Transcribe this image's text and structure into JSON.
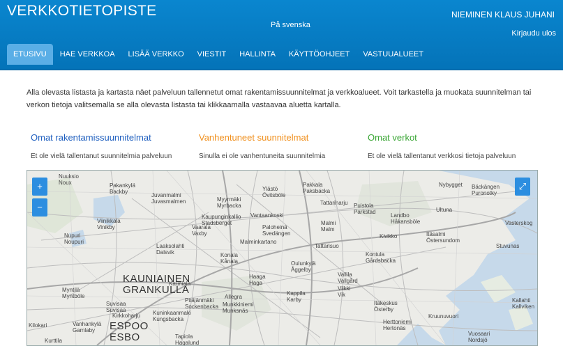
{
  "header": {
    "brand": "VERKKOTIETOPISTE",
    "language_link": "På svenska",
    "user_name": "NIEMINEN KLAUS JUHANI",
    "logout": "Kirjaudu ulos"
  },
  "nav": {
    "tabs": [
      {
        "label": "ETUSIVU",
        "active": true
      },
      {
        "label": "HAE VERKKOA",
        "active": false
      },
      {
        "label": "LISÄÄ VERKKO",
        "active": false
      },
      {
        "label": "VIESTIT",
        "active": false
      },
      {
        "label": "HALLINTA",
        "active": false
      },
      {
        "label": "KÄYTTÖOHJEET",
        "active": false
      },
      {
        "label": "VASTUUALUEET",
        "active": false
      }
    ]
  },
  "intro": "Alla olevasta listasta ja kartasta näet palveluun tallennetut omat rakentamissuunnitelmat ja verkkoalueet. Voit tarkastella ja muokata suunnitelman tai verkon tietoja valitsemalla se alla olevasta listasta tai klikkaamalla vastaavaa aluetta kartalla.",
  "sections": {
    "plans": {
      "title": "Omat rakentamissuunnitelmat",
      "text": "Et ole vielä tallentanut suunnitelmia palveluun",
      "color": "#1f5fbf"
    },
    "expired": {
      "title": "Vanhentuneet suunnitelmat",
      "text": "Sinulla ei ole vanhentuneita suunnitelmia",
      "color": "#f0901e"
    },
    "networks": {
      "title": "Omat verkot",
      "text": "Et ole vielä tallentanut verkkosi tietoja palveluun",
      "color": "#3aa635"
    }
  },
  "map": {
    "zoom_in": "+",
    "zoom_out": "−",
    "fullscreen": "⤢",
    "place_labels": [
      "Nuuksio\nNoux",
      "Pakankylä\nBackby",
      "Juvanmalmi\nJuvasmalmen",
      "Myyrmäki\nMyrbacka",
      "Vaarala\nVaxby",
      "Viinikkala\nVinikby",
      "Nupuri\nNoupuri",
      "Laaksolahti\nDalsvik",
      "Kaupunginkallio\nStadsberget",
      "Vantaankoski",
      "Ylästö\nÖvitsböle",
      "Pakkala\nPaksbacka",
      "Paloheinä\nSvedängen",
      "Malmi\nMalm",
      "Puistola\nParkstad",
      "Tattariharju",
      "Kivikko",
      "Itäsalmi\nÖstersundom",
      "Nybygget",
      "Bäckängen\nPuronotky",
      "Ultuna",
      "Landbo\nHåkansböle",
      "Vasterskog",
      "Kontula\nGårdsbacka",
      "Stuvunas",
      "KAUNIAINEN\nGRANKULLA",
      "ESPOO\nESBO",
      "Konala\nKånala",
      "Oulunkylä\nÅggelby",
      "Vallila\nVallgård",
      "Myntilä\nMyntböle",
      "Suvisaa\nSuvisaa",
      "Vanhankylä\nGamlaby",
      "Kilokari",
      "Kuninkaanmaki\nKungsbacka",
      "Kruunuvuori",
      "Malminkartano",
      "Tattarisuo",
      "Viikki\nVik",
      "Kappila\nKarby",
      "Haaga\nHaga",
      "Munkkiniemi\nMunksnäs",
      "Itäkeskus\nÖsterby",
      "Herttoniemi\nHertonäs",
      "Kauniala",
      "Kirkkoharju",
      "Kurttila",
      "Tapiola\nHagalund",
      "Pitäjänmäki\nSockenbacka",
      "Allegra",
      "Kallahti\nKallviken",
      "Vuosaari\nNordsjö"
    ]
  }
}
